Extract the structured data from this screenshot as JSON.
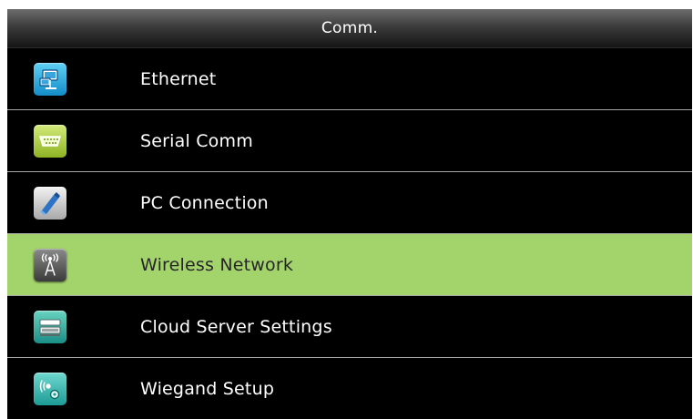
{
  "header": {
    "title": "Comm."
  },
  "colors": {
    "selected_background": "#a3d36b",
    "screen_background": "#000000",
    "divider": "#a8a8a8"
  },
  "menu": {
    "items": [
      {
        "label": "Ethernet",
        "icon": "ethernet-icon",
        "selected": false
      },
      {
        "label": "Serial Comm",
        "icon": "serial-port-icon",
        "selected": false
      },
      {
        "label": "PC Connection",
        "icon": "pc-connection-icon",
        "selected": false
      },
      {
        "label": "Wireless Network",
        "icon": "wireless-antenna-icon",
        "selected": true
      },
      {
        "label": "Cloud Server Settings",
        "icon": "cloud-server-icon",
        "selected": false
      },
      {
        "label": "Wiegand Setup",
        "icon": "wiegand-icon",
        "selected": false
      }
    ]
  }
}
